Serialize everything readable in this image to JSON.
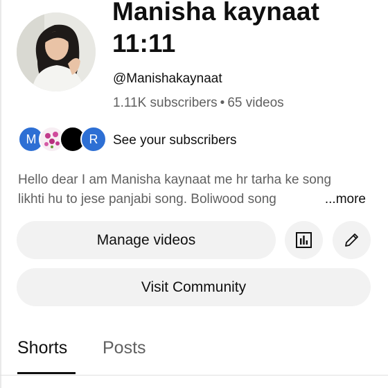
{
  "channel": {
    "name": "Manisha kaynaat 11:11",
    "handle": "@Manishakaynaat",
    "subscribers": "1.11K subscribers",
    "separator": "•",
    "videos": "65 videos"
  },
  "subscribers_preview": {
    "avatars": [
      "M",
      "",
      "",
      "R"
    ],
    "label": "See your subscribers"
  },
  "description": {
    "line1": "Hello dear I am Manisha kaynaat me hr tarha ke song",
    "line2": "likhti hu to jese panjabi song. Boliwood song",
    "more": "...more"
  },
  "actions": {
    "manage_videos": "Manage videos",
    "analytics_icon": "analytics-icon",
    "edit_icon": "pencil-icon",
    "visit_community": "Visit Community"
  },
  "tabs": [
    "Shorts",
    "Posts"
  ],
  "colors": {
    "text_primary": "#0f0f0f",
    "text_secondary": "#606060",
    "pill_bg": "#f2f2f2",
    "avatar_blue": "#2d6fd4"
  }
}
